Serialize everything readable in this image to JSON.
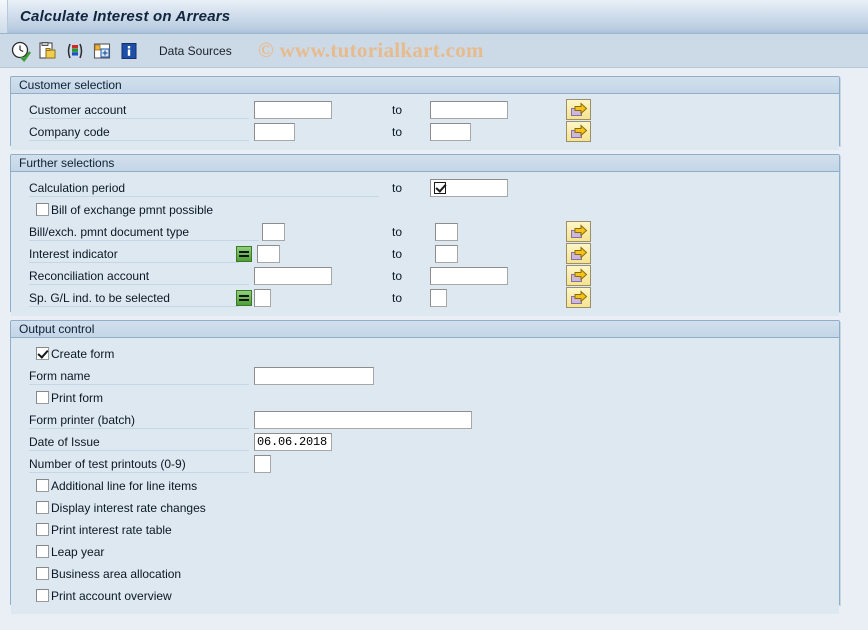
{
  "window": {
    "title": "Calculate Interest on Arrears"
  },
  "toolbar": {
    "icons": [
      {
        "name": "execute-clock-icon"
      },
      {
        "name": "copy-variant-icon"
      },
      {
        "name": "selection-options-icon"
      },
      {
        "name": "dynamic-selections-icon"
      },
      {
        "name": "info-icon"
      }
    ],
    "data_sources_label": "Data Sources"
  },
  "watermark": "© www.tutorialkart.com",
  "sections": {
    "customer_selection": {
      "header": "Customer selection",
      "rows": [
        {
          "label": "Customer account",
          "from_value": "",
          "to_label": "to",
          "to_value": "",
          "has_arrow": true,
          "has_eq_icon": false,
          "from_width": "wide",
          "to_width": "wide"
        },
        {
          "label": "Company code",
          "from_value": "",
          "to_label": "to",
          "to_value": "",
          "has_arrow": true,
          "has_eq_icon": false,
          "from_width": "narrow",
          "to_width": "narrow"
        }
      ]
    },
    "further_selections": {
      "header": "Further selections",
      "calculation_period": {
        "label": "Calculation period",
        "to_label": "to",
        "to_value": "",
        "inline_checkbox_checked": true
      },
      "bill_of_exchange_checkbox": {
        "label": "Bill of exchange pmnt possible",
        "checked": false
      },
      "rows": [
        {
          "label": "Bill/exch. pmnt document type",
          "from_value": "",
          "to_label": "to",
          "to_value": "",
          "has_arrow": true,
          "has_eq_icon": false,
          "from_width": "tiny",
          "to_width": "tiny"
        },
        {
          "label": "Interest indicator",
          "from_value": "",
          "to_label": "to",
          "to_value": "",
          "has_arrow": true,
          "has_eq_icon": true,
          "from_width": "tiny",
          "to_width": "tiny"
        },
        {
          "label": "Reconciliation account",
          "from_value": "",
          "to_label": "to",
          "to_value": "",
          "has_arrow": true,
          "has_eq_icon": false,
          "from_width": "wide",
          "to_width": "wide"
        },
        {
          "label": "Sp. G/L ind. to be selected",
          "from_value": "",
          "to_label": "to",
          "to_value": "",
          "has_arrow": true,
          "has_eq_icon": true,
          "from_width": "xtiny",
          "to_width": "xtiny"
        }
      ]
    },
    "output_control": {
      "header": "Output control",
      "create_form": {
        "label": "Create form",
        "checked": true
      },
      "form_name": {
        "label": "Form name",
        "value": ""
      },
      "print_form": {
        "label": "Print form",
        "checked": false
      },
      "form_printer": {
        "label": "Form printer (batch)",
        "value": ""
      },
      "date_of_issue": {
        "label": "Date of Issue",
        "value": "06.06.2018"
      },
      "test_printouts": {
        "label": "Number of test printouts (0-9)",
        "value": ""
      },
      "checkboxes": [
        {
          "label": "Additional line for line items",
          "checked": false
        },
        {
          "label": "Display interest rate changes",
          "checked": false
        },
        {
          "label": "Print interest rate table",
          "checked": false
        },
        {
          "label": "Leap year",
          "checked": false
        },
        {
          "label": "Business area allocation",
          "checked": false
        },
        {
          "label": "Print account overview",
          "checked": false
        }
      ]
    }
  },
  "colors": {
    "title_gradient_top": "#e9f0f8",
    "title_gradient_bottom": "#a9c0da",
    "toolbar_bg": "#ccd9e6",
    "page_bg": "#eaeff5",
    "group_bg": "#dde8f1",
    "group_header_bg": "#c3d5e7",
    "group_border": "#8faec9",
    "watermark_color": "#e8bb8c",
    "eq_icon_green": "#4e9e36",
    "arrow_btn_yellow": "#f6e48d"
  }
}
